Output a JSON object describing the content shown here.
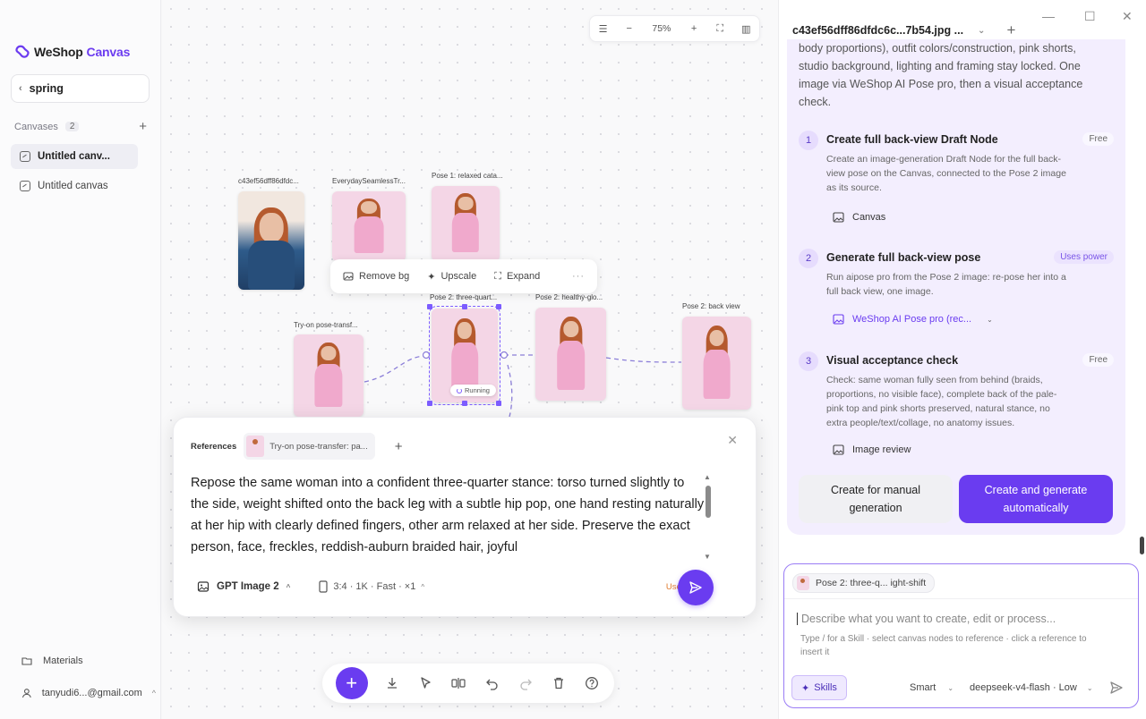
{
  "sidebar": {
    "logo": {
      "brand": "WeShop",
      "product": "Canvas"
    },
    "project": "spring",
    "canvases_label": "Canvases",
    "canvases_count": "2",
    "canvases": [
      {
        "label": "Untitled canv...",
        "active": true
      },
      {
        "label": "Untitled canvas",
        "active": false
      }
    ],
    "materials": "Materials",
    "account": "tanyudi6...@gmail.com"
  },
  "canvas": {
    "zoom": "75%",
    "nodes": [
      {
        "label": "c43ef56dff86dfdc...",
        "style": "blue"
      },
      {
        "label": "EverydaySeamlessTr...",
        "style": "pink"
      },
      {
        "label": "Pose 1: relaxed cata...",
        "style": "pink"
      },
      {
        "label": "Try-on pose-transf...",
        "style": "pink"
      },
      {
        "label": "Pose 2: three-quart...",
        "style": "pink",
        "status": "Running"
      },
      {
        "label": "Pose 2: healthy-glo...",
        "style": "pink"
      },
      {
        "label": "Pose 2: back view",
        "style": "pink"
      }
    ],
    "node_toolbar": {
      "remove_bg": "Remove bg",
      "upscale": "Upscale",
      "expand": "Expand",
      "more": "···"
    }
  },
  "prompt": {
    "references_label": "References",
    "reference_chip": "Try-on pose-transfer: pa...",
    "text": "Repose the same woman into a confident three-quarter stance: torso turned slightly to the side, weight shifted onto the back leg with a subtle hip pop, one hand resting naturally at her hip with clearly defined fingers, other arm relaxed at her side. Preserve the exact person, face, freckles, reddish-auburn braided hair, joyful",
    "model": "GPT Image 2",
    "options": "3:4 · 1K · Fast · ×1",
    "power": "Uses power"
  },
  "right_panel": {
    "title": "c43ef56dff86dfdc6c...7b54.jpg ...",
    "intro": "body proportions), outfit colors/construction, pink shorts, studio background, lighting and framing stay locked. One image via WeShop AI Pose pro, then a visual acceptance check.",
    "steps": [
      {
        "num": "1",
        "title": "Create full back-view Draft Node",
        "badge": "Free",
        "desc": "Create an image-generation Draft Node for the full back-view pose on the Canvas, connected to the Pose 2 image as its source.",
        "tool": "Canvas"
      },
      {
        "num": "2",
        "title": "Generate full back-view pose",
        "badge": "Uses power",
        "desc": "Run aipose pro from the Pose 2 image: re-pose her into a full back view, one image.",
        "tool": "WeShop AI Pose pro (rec..."
      },
      {
        "num": "3",
        "title": "Visual acceptance check",
        "badge": "Free",
        "desc": "Check: same woman fully seen from behind (braids, proportions, no visible face), complete back of the pale-pink top and pink shorts preserved, natural stance, no extra people/text/collage, no anatomy issues.",
        "tool": "Image review"
      }
    ],
    "btn_manual": "Create for manual generation",
    "btn_auto": "Create and generate automatically",
    "chat": {
      "chip": "Pose 2: three-q... ight-shift",
      "placeholder": "Describe what you want to create, edit or process...",
      "hint": "Type / for a Skill · select canvas nodes to reference · click a reference to insert it",
      "skills": "Skills",
      "mode": "Smart",
      "model": "deepseek-v4-flash · Low"
    }
  },
  "colors": {
    "accent": "#6a3cf0",
    "power": "#e07a2c"
  }
}
